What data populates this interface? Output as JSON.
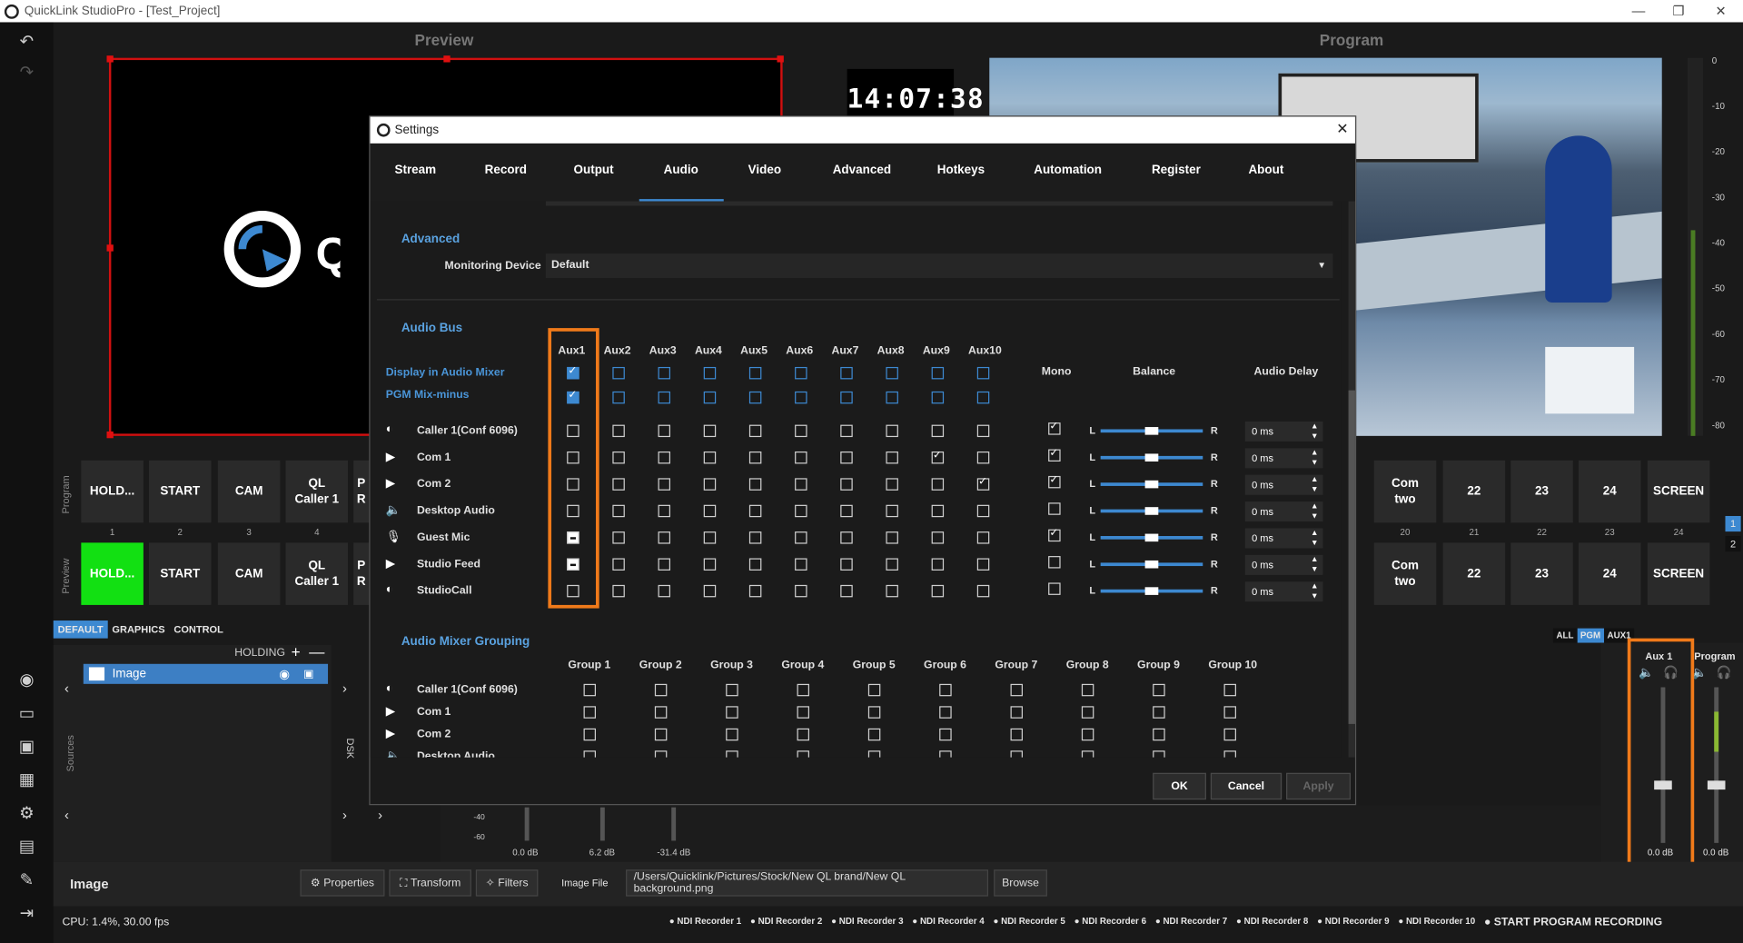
{
  "window": {
    "title": "QuickLink StudioPro  - [Test_Project]"
  },
  "panels": {
    "preview_label": "Preview",
    "program_label": "Program",
    "clock": "14:07:38"
  },
  "meter_ticks": [
    "0",
    "-10",
    "-20",
    "-30",
    "-40",
    "-50",
    "-60",
    "-70",
    "-80"
  ],
  "scenes": {
    "program_row_label": "Program",
    "preview_row_label": "Preview",
    "left_buttons": [
      "HOLD...",
      "START",
      "CAM",
      "QL\nCaller 1",
      "P\nR"
    ],
    "left_numbers": [
      "1",
      "2",
      "3",
      "4"
    ],
    "right_buttons": [
      "Com\ntwo",
      "22",
      "23",
      "24",
      "SCREEN"
    ],
    "right_numbers": [
      "20",
      "21",
      "22",
      "23",
      "24"
    ],
    "page_numbers": [
      "1",
      "2"
    ]
  },
  "tabs_small": [
    "DEFAULT",
    "GRAPHICS",
    "CONTROL"
  ],
  "sources": {
    "header": "HOLDING",
    "item": "Image",
    "side_label": "Sources",
    "dsk_label": "DSK"
  },
  "mixer_tabs": [
    "ALL",
    "PGM",
    "AUX1"
  ],
  "mixer": {
    "channels": [
      {
        "name": "Aux 1",
        "db": "0.0 dB"
      },
      {
        "name": "Program",
        "db": "0.0 dB"
      }
    ],
    "strip_db": [
      "0.0 dB",
      "6.2 dB",
      "-31.4 dB"
    ],
    "scale": [
      "-40",
      "-60"
    ]
  },
  "bottom": {
    "section": "Image",
    "properties": "Properties",
    "transform": "Transform",
    "filters": "Filters",
    "image_file_label": "Image File",
    "image_file_value": "/Users/Quicklink/Pictures/Stock/New QL brand/New QL background.png",
    "browse": "Browse",
    "cpu": "CPU: 1.4%, 30.00 fps",
    "recorders": [
      "NDI Recorder 1",
      "NDI Recorder 2",
      "NDI Recorder 3",
      "NDI Recorder 4",
      "NDI Recorder 5",
      "NDI Recorder 6",
      "NDI Recorder 7",
      "NDI Recorder 8",
      "NDI Recorder 9",
      "NDI Recorder 10"
    ],
    "start_recording": "START PROGRAM RECORDING"
  },
  "settings": {
    "title": "Settings",
    "tabs": [
      "Stream",
      "Record",
      "Output",
      "Audio",
      "Video",
      "Advanced",
      "Hotkeys",
      "Automation",
      "Register",
      "About"
    ],
    "active_tab": "Audio",
    "advanced_header": "Advanced",
    "monitoring_label": "Monitoring Device",
    "monitoring_value": "Default",
    "audio_bus_header": "Audio Bus",
    "aux_headers": [
      "Aux1",
      "Aux2",
      "Aux3",
      "Aux4",
      "Aux5",
      "Aux6",
      "Aux7",
      "Aux8",
      "Aux9",
      "Aux10"
    ],
    "display_in_mixer_label": "Display in Audio Mixer",
    "pgm_mix_minus_label": "PGM Mix-minus",
    "mono_label": "Mono",
    "balance_label": "Balance",
    "delay_label": "Audio Delay",
    "balance_left": "L",
    "balance_right": "R",
    "sources": [
      {
        "name": "Caller 1(Conf 6096)",
        "icon": "quicklink-icon",
        "aux": [
          0,
          0,
          0,
          0,
          0,
          0,
          0,
          0,
          0,
          0
        ],
        "mono": true,
        "delay": "0 ms"
      },
      {
        "name": "Com 1",
        "icon": "play-icon",
        "aux": [
          0,
          0,
          0,
          0,
          0,
          0,
          0,
          0,
          1,
          0
        ],
        "mono": true,
        "delay": "0 ms"
      },
      {
        "name": "Com 2",
        "icon": "play-icon",
        "aux": [
          0,
          0,
          0,
          0,
          0,
          0,
          0,
          0,
          0,
          1
        ],
        "mono": true,
        "delay": "0 ms"
      },
      {
        "name": "Desktop Audio",
        "icon": "speaker-icon",
        "aux": [
          0,
          0,
          0,
          0,
          0,
          0,
          0,
          0,
          0,
          0
        ],
        "mono": false,
        "delay": "0 ms"
      },
      {
        "name": "Guest Mic",
        "icon": "mic-icon",
        "aux": [
          2,
          0,
          0,
          0,
          0,
          0,
          0,
          0,
          0,
          0
        ],
        "mono": true,
        "delay": "0 ms"
      },
      {
        "name": "Studio Feed",
        "icon": "play-icon",
        "aux": [
          2,
          0,
          0,
          0,
          0,
          0,
          0,
          0,
          0,
          0
        ],
        "mono": false,
        "delay": "0 ms"
      },
      {
        "name": "StudioCall",
        "icon": "quicklink-icon",
        "aux": [
          0,
          0,
          0,
          0,
          0,
          0,
          0,
          0,
          0,
          0
        ],
        "mono": false,
        "delay": "0 ms"
      }
    ],
    "grouping_header": "Audio Mixer Grouping",
    "group_headers": [
      "Group 1",
      "Group 2",
      "Group 3",
      "Group 4",
      "Group 5",
      "Group 6",
      "Group 7",
      "Group 8",
      "Group 9",
      "Group 10"
    ],
    "group_sources": [
      "Caller 1(Conf 6096)",
      "Com 1",
      "Com 2",
      "Desktop Audio"
    ],
    "ok": "OK",
    "cancel": "Cancel",
    "apply": "Apply"
  },
  "colors": {
    "accent": "#3d89d1",
    "highlight": "#f07a1a",
    "preview_active": "#12e012",
    "tally": "#d01010"
  }
}
